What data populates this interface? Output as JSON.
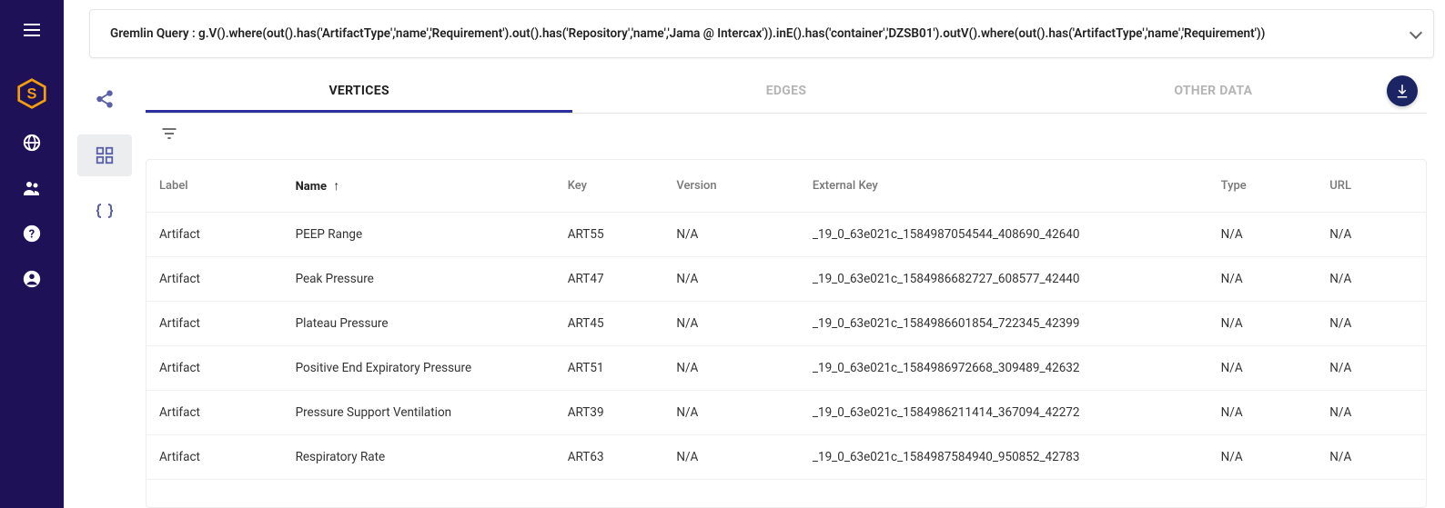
{
  "query": "Gremlin Query : g.V().where(out().has('ArtifactType','name','Requirement').out().has('Repository','name','Jama @ Intercax')).inE().has('container','DZSB01').outV().where(out().has('ArtifactType','name','Requirement'))",
  "tabs": {
    "vertices": "VERTICES",
    "edges": "EDGES",
    "other": "OTHER DATA"
  },
  "columns": {
    "label": "Label",
    "name": "Name",
    "key": "Key",
    "version": "Version",
    "externalKey": "External Key",
    "type": "Type",
    "url": "URL"
  },
  "sortArrow": "↑",
  "rows": [
    {
      "label": "Artifact",
      "name": "PEEP Range",
      "key": "ART55",
      "version": "N/A",
      "externalKey": "_19_0_63e021c_1584987054544_408690_42640",
      "type": "N/A",
      "url": "N/A"
    },
    {
      "label": "Artifact",
      "name": "Peak Pressure",
      "key": "ART47",
      "version": "N/A",
      "externalKey": "_19_0_63e021c_1584986682727_608577_42440",
      "type": "N/A",
      "url": "N/A"
    },
    {
      "label": "Artifact",
      "name": "Plateau Pressure",
      "key": "ART45",
      "version": "N/A",
      "externalKey": "_19_0_63e021c_1584986601854_722345_42399",
      "type": "N/A",
      "url": "N/A"
    },
    {
      "label": "Artifact",
      "name": "Positive End Expiratory Pressure",
      "key": "ART51",
      "version": "N/A",
      "externalKey": "_19_0_63e021c_1584986972668_309489_42632",
      "type": "N/A",
      "url": "N/A"
    },
    {
      "label": "Artifact",
      "name": "Pressure Support Ventilation",
      "key": "ART39",
      "version": "N/A",
      "externalKey": "_19_0_63e021c_1584986211414_367094_42272",
      "type": "N/A",
      "url": "N/A"
    },
    {
      "label": "Artifact",
      "name": "Respiratory Rate",
      "key": "ART63",
      "version": "N/A",
      "externalKey": "_19_0_63e021c_1584987584940_950852_42783",
      "type": "N/A",
      "url": "N/A"
    }
  ]
}
